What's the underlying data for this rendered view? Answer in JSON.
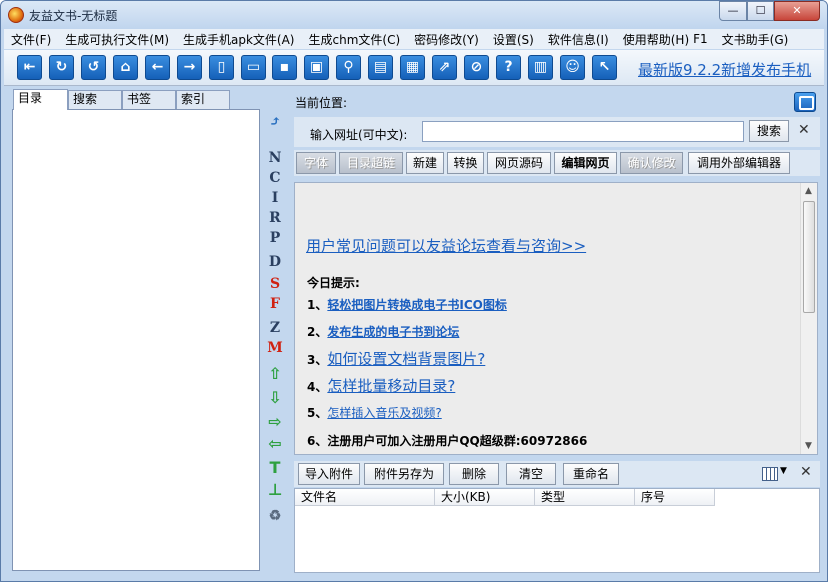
{
  "window": {
    "title": "友益文书-无标题"
  },
  "menu": [
    "文件(F)",
    "生成可执行文件(M)",
    "生成手机apk文件(A)",
    "生成chm文件(C)",
    "密码修改(Y)",
    "设置(S)",
    "软件信息(I)",
    "使用帮助(H)",
    "F1",
    "文书助手(G)"
  ],
  "toolbar": {
    "icons": [
      "exit-icon",
      "refresh-icon",
      "reload-icon",
      "home-icon",
      "back-icon",
      "forward-icon",
      "new-doc-icon",
      "open-folder-icon",
      "save-icon",
      "save-as-icon",
      "search-icon",
      "camera-icon",
      "notes-icon",
      "export-icon",
      "link-icon",
      "help-icon",
      "book-icon",
      "smile-icon",
      "pointer-icon"
    ],
    "glyphs": [
      "⇤",
      "↻",
      "↺",
      "⌂",
      "←",
      "→",
      "▯",
      "▭",
      "▪",
      "▣",
      "⚲",
      "▤",
      "▦",
      "⇗",
      "⊘",
      "?",
      "▥",
      "☺",
      "↖"
    ],
    "news": "最新版9.2.2新增发布手机"
  },
  "left": {
    "tabs": [
      "目录",
      "搜索",
      "书签",
      "索引"
    ],
    "side_tools": [
      "N",
      "C",
      "I",
      "R",
      "P",
      "D",
      "S",
      "F",
      "Z",
      "M"
    ],
    "side_arrows": [
      "⇧",
      "⇩",
      "⇨",
      "⇦",
      "T",
      "⊥"
    ]
  },
  "right": {
    "location_label": "当前位置:",
    "url_label": "输入网址(可中文):",
    "url_value": "",
    "search_label": "搜索",
    "close": "✕",
    "edit_buttons": [
      "字体",
      "目录超链",
      "新建",
      "转换",
      "网页源码",
      "编辑网页",
      "确认修改",
      "调用外部编辑器"
    ],
    "faq": "用户常见问题可以友益论坛查看与咨询>>",
    "tips_title": "今日提示:",
    "tips": [
      {
        "num": "1、",
        "text": "轻松把图片转换成电子书ICO图标"
      },
      {
        "num": "2、",
        "text": "发布生成的电子书到论坛"
      },
      {
        "num": "3、",
        "text": "如何设置文档背景图片?"
      },
      {
        "num": "4、",
        "text": "怎样批量移动目录?"
      },
      {
        "num": "5、",
        "text": "怎样插入音乐及视频?"
      },
      {
        "num": "6、",
        "text": "注册用户可加入注册用户QQ超级群:60972866"
      }
    ],
    "attach_buttons": [
      "导入附件",
      "附件另存为",
      "删除",
      "清空",
      "重命名"
    ],
    "columns": [
      "文件名",
      "大小(KB)",
      "类型",
      "序号"
    ]
  }
}
